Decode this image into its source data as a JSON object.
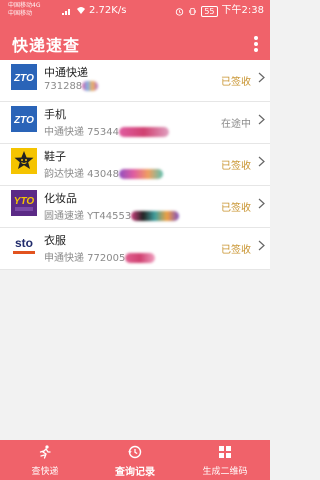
{
  "statusbar": {
    "carrier1": "中国移动4G",
    "carrier2": "中国移动",
    "speed": "2.72K/s",
    "battery": "55",
    "time": "下午2:38"
  },
  "appbar": {
    "title": "快递速查"
  },
  "items": [
    {
      "name": "中通快递",
      "sub": "731288",
      "status": "已签收",
      "status_color": "#c8932e",
      "logo": "zto"
    },
    {
      "name": "手机",
      "sub": "中通快递 75344",
      "status": "在途中",
      "status_color": "#888888",
      "logo": "zto"
    },
    {
      "name": "鞋子",
      "sub": "韵达快递 43048",
      "status": "已签收",
      "status_color": "#c8932e",
      "logo": "yunda"
    },
    {
      "name": "化妆品",
      "sub": "圆通速递 YT44553",
      "status": "已签收",
      "status_color": "#c8932e",
      "logo": "yto"
    },
    {
      "name": "衣服",
      "sub": "申通快递 772005",
      "status": "已签收",
      "status_color": "#c8932e",
      "logo": "sto"
    }
  ],
  "tabs": [
    {
      "label": "查快递",
      "icon": "runner-icon"
    },
    {
      "label": "查询记录",
      "icon": "history-icon"
    },
    {
      "label": "生成二维码",
      "icon": "grid-icon"
    }
  ],
  "colors": {
    "brand": "#f0626a",
    "signed": "#c8932e",
    "in_transit": "#888888"
  }
}
